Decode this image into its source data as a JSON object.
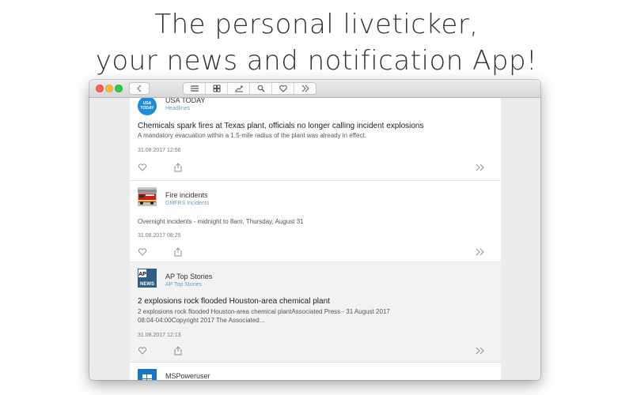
{
  "headline": {
    "line1": "The personal liveticker,",
    "line2": "your news and notification App!"
  },
  "window": {
    "toolbar": {
      "back": "back-icon",
      "buttons": [
        "list-icon",
        "grid-icon",
        "chart-icon",
        "search-icon",
        "heart-icon",
        "forward-icon"
      ]
    }
  },
  "feed": {
    "items": [
      {
        "source": "USA TODAY",
        "subsource": "Headlines",
        "logo_text": "USA TODAY",
        "title": "Chemicals spark fires at Texas plant, officials no longer calling incident explosions",
        "description": "A mandatory evacuation within a 1.5-mile radius of the plant was already in effect.",
        "timestamp": "31.08.2017 12:56"
      },
      {
        "source": "Fire incidents",
        "subsource": "GMFRS Incidents",
        "title": "",
        "description": "Overnight incidents - midnight to 8am, Thursday, August 31",
        "timestamp": "31.08.2017 08:25"
      },
      {
        "source": "AP Top Stories",
        "subsource": "AP Top Stories",
        "logo_text_top": "AP",
        "logo_text_bottom": "NEWS",
        "title": "2 explosions rock flooded Houston-area chemical plant",
        "description_line1": "2 explosions rock flooded Houston-area chemical plantAssociated Press - 31 August 2017",
        "description_line2": "08:04-04:00Copyright 2017 The Associated...",
        "timestamp": "31.08.2017 12:13"
      },
      {
        "source": "MSPoweruser"
      }
    ]
  },
  "colors": {
    "subsource": "#6b9fb6",
    "usa_today_blue": "#1a8cd8",
    "ap_blue": "#2f5d84"
  }
}
